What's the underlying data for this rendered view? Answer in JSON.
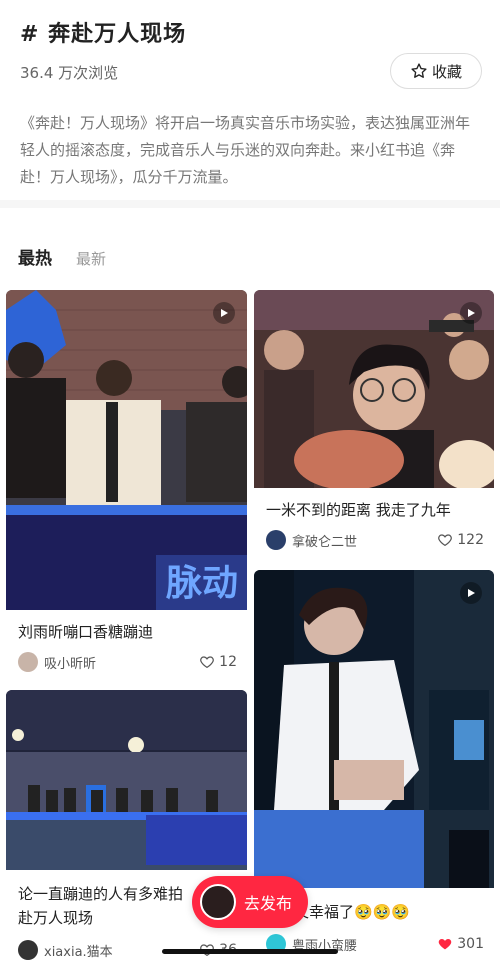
{
  "topic": {
    "title": "# 奔赴万人现场",
    "views": "36.4 万次浏览",
    "fav_label": "收藏"
  },
  "description": "《奔赴！万人现场》将开启一场真实音乐市场实验，表达独属亚洲年轻人的摇滚态度，完成音乐人与乐迷的双向奔赴。来小红书追《奔赴！万人现场》，瓜分千万流量。",
  "tabs": {
    "hot": "最热",
    "new": "最新"
  },
  "cards": [
    {
      "title": "刘雨昕嘣口香糖蹦迪",
      "author": "吸小昕昕",
      "likes": "12",
      "overlay_text": "脉动"
    },
    {
      "title": "一米不到的距离 我走了九年",
      "author": "拿破仑二世",
      "likes": "122"
    },
    {
      "title_line1": "论一直蹦迪的人有多难拍",
      "title_line2": "赴万人现场",
      "author": "xiaxia.猫本",
      "likes": "36"
    },
    {
      "title": "又幸福了🥹🥹🥹",
      "author": "粤雨小蛮腰",
      "likes": "301"
    }
  ],
  "publish": {
    "label": "去发布"
  },
  "colors": {
    "accent": "#ff2741"
  }
}
